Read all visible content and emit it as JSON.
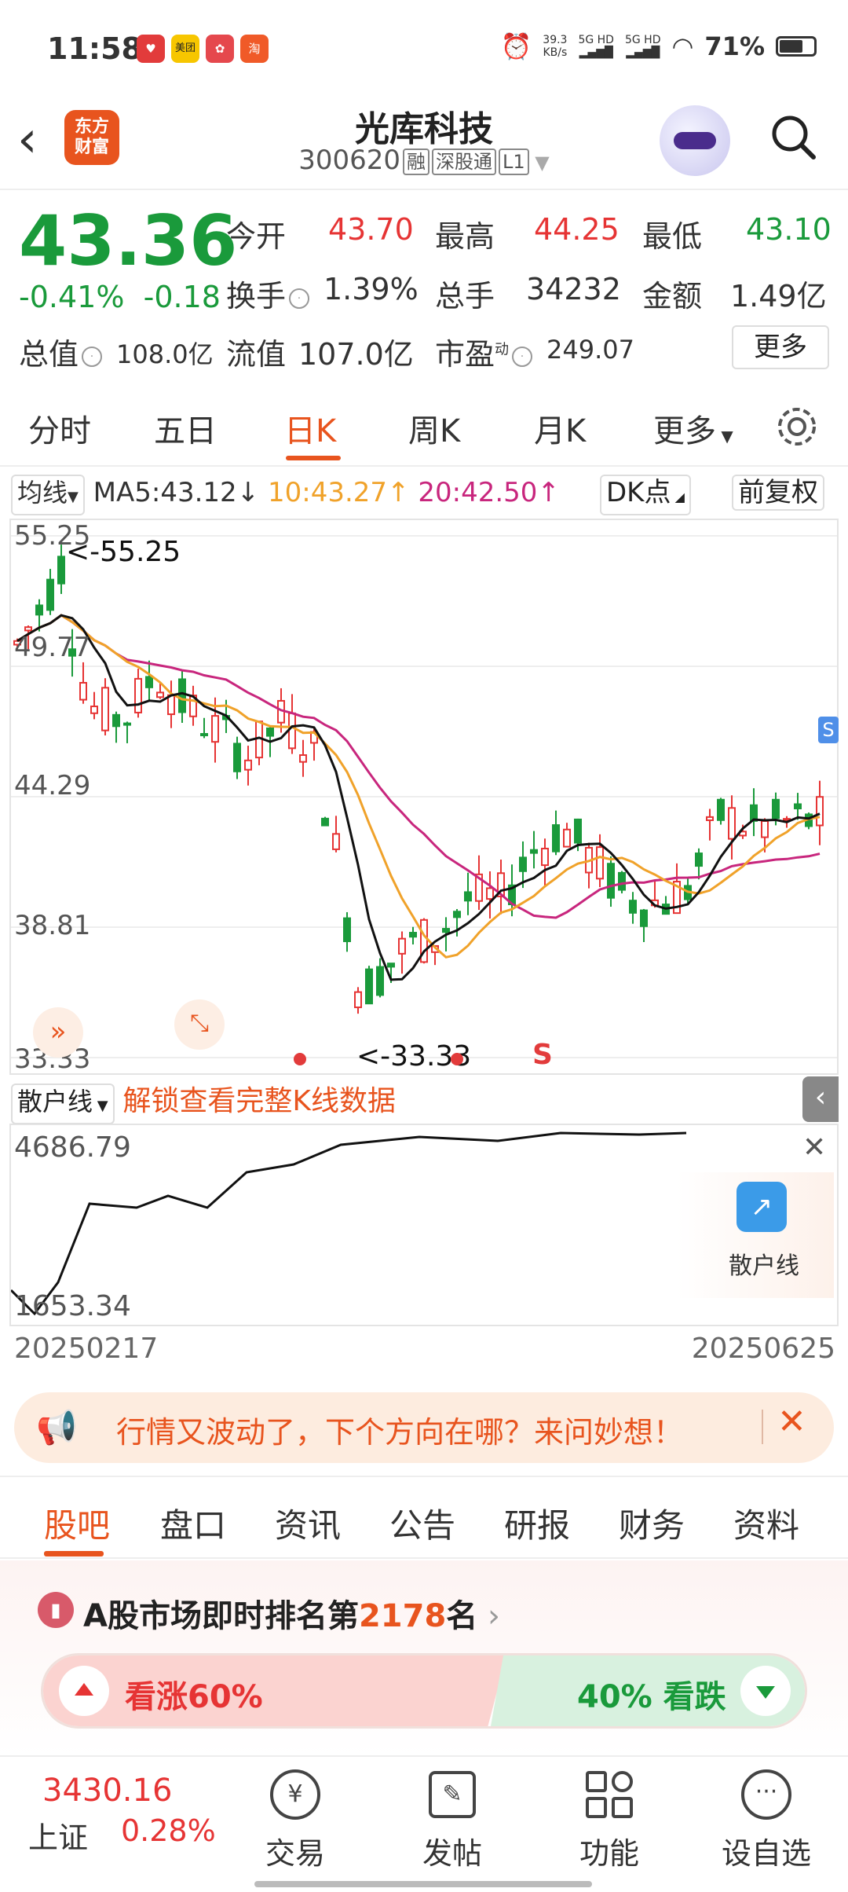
{
  "status_bar": {
    "time": "11:58",
    "net_speed": "39.3",
    "net_unit": "KB/s",
    "sig1": "5G HD",
    "sig2": "5G HD",
    "battery": "71%",
    "app_icons": [
      "app1",
      "美团",
      "app3",
      "app4"
    ]
  },
  "header": {
    "title": "光库科技",
    "code": "300620",
    "tags": [
      "融",
      "深股通",
      "L1"
    ],
    "logo_line1": "东方",
    "logo_line2": "财富"
  },
  "quote": {
    "price": "43.36",
    "change_pct": "-0.41%",
    "change_amt": "-0.18",
    "open_label": "今开",
    "open": "43.70",
    "high_label": "最高",
    "high": "44.25",
    "low_label": "最低",
    "low": "43.10",
    "turnover_label": "换手",
    "turnover": "1.39%",
    "volume_label": "总手",
    "volume": "34232",
    "amount_label": "金额",
    "amount": "1.49亿",
    "mcap_label": "总值",
    "mcap": "108.0亿",
    "float_label": "流值",
    "float": "107.0亿",
    "pe_label": "市盈",
    "pe_sup": "动",
    "pe": "249.07",
    "more": "更多"
  },
  "tabs": [
    "分时",
    "五日",
    "日K",
    "周K",
    "月K",
    "更多"
  ],
  "ma": {
    "selector": "均线",
    "ma5": "MA5:43.12",
    "ma10": "10:43.27",
    "ma20": "20:42.50",
    "dk": "DK点",
    "adjust": "前复权"
  },
  "chart_data": {
    "type": "candlestick",
    "y_ticks": [
      "55.25",
      "49.77",
      "44.29",
      "38.81",
      "33.33"
    ],
    "ylim": [
      33.33,
      55.25
    ],
    "max_label": "<-55.25",
    "min_label": "<-33.33",
    "signal_label": "S",
    "flag_label": "S",
    "lower": {
      "indicator": "散户线",
      "ticks": [
        "4686.79",
        "1653.34"
      ],
      "start_date": "20250217",
      "end_date": "20250625",
      "unlock_text": "解锁查看完整K线数据",
      "badge_label": "散户线"
    }
  },
  "promo": {
    "text": "行情又波动了，下个方向在哪？来问妙想！"
  },
  "sub_tabs": [
    "股吧",
    "盘口",
    "资讯",
    "公告",
    "研报",
    "财务",
    "资料"
  ],
  "rank": {
    "prefix": "A股市场即时排名第",
    "number": "2178",
    "suffix": "名"
  },
  "vote": {
    "up": "看涨60%",
    "down": "40% 看跌"
  },
  "bottom_nav": {
    "index_value": "3430.16",
    "index_name": "上证",
    "index_change": "0.28%",
    "items": [
      "交易",
      "发帖",
      "功能",
      "设自选"
    ]
  }
}
